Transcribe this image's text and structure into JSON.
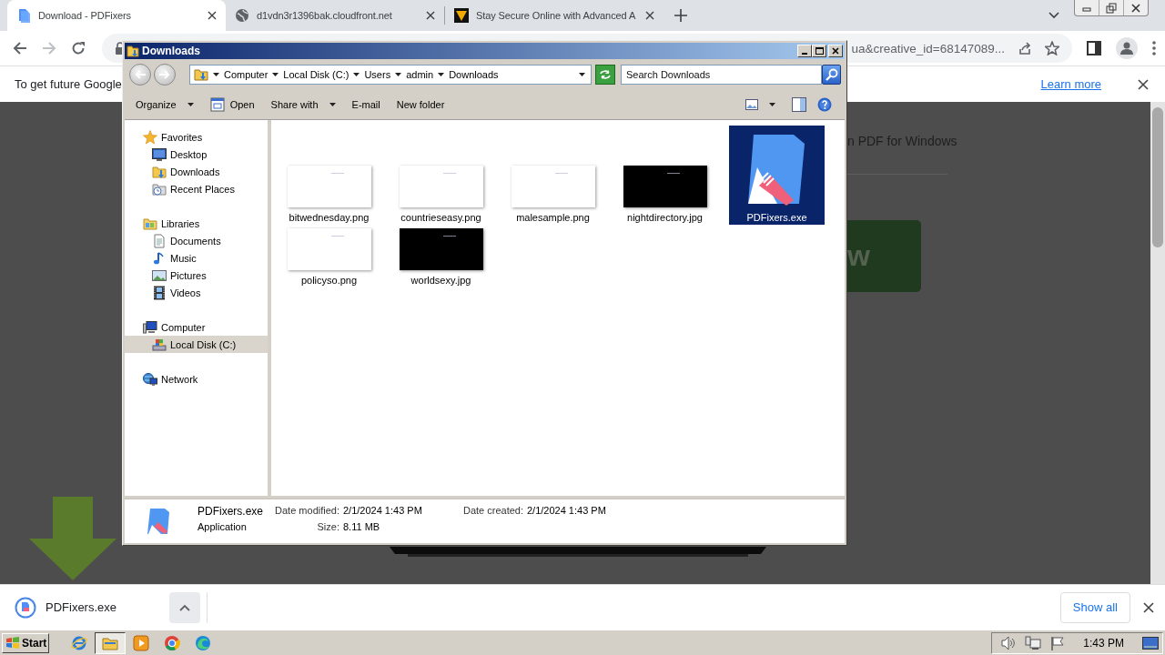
{
  "browser": {
    "tabs": [
      {
        "title": "Download - PDFixers",
        "selected": true
      },
      {
        "title": "d1vdn3r1396bak.cloudfront.net",
        "selected": false
      },
      {
        "title": "Stay Secure Online with Advanced A",
        "selected": false
      }
    ],
    "url": "ua&creative_id=68147089...",
    "infobar": {
      "message": "To get future Google",
      "link": "Learn more"
    },
    "page": {
      "heading": "n PDF for Windows",
      "button": "w"
    },
    "download_shelf": {
      "file": "PDFixers.exe",
      "show_all": "Show all"
    }
  },
  "explorer": {
    "title": "Downloads",
    "breadcrumb": [
      "Computer",
      "Local Disk (C:)",
      "Users",
      "admin",
      "Downloads"
    ],
    "search_placeholder": "Search Downloads",
    "toolbar": [
      {
        "label": "Organize",
        "kind": "menu"
      },
      {
        "label": "Open",
        "kind": "open"
      },
      {
        "label": "Share with",
        "kind": "menu"
      },
      {
        "label": "E-mail",
        "kind": "plain"
      },
      {
        "label": "New folder",
        "kind": "plain"
      }
    ],
    "nav": [
      {
        "label": "Favorites",
        "kind": "star",
        "selected": false,
        "children": [
          {
            "label": "Desktop",
            "kind": "desktop",
            "selected": false
          },
          {
            "label": "Downloads",
            "kind": "downloads",
            "selected": false
          },
          {
            "label": "Recent Places",
            "kind": "recent",
            "selected": false
          }
        ]
      },
      {
        "label": "Libraries",
        "kind": "libraries",
        "selected": false,
        "children": [
          {
            "label": "Documents",
            "kind": "documents",
            "selected": false
          },
          {
            "label": "Music",
            "kind": "music",
            "selected": false
          },
          {
            "label": "Pictures",
            "kind": "pictures",
            "selected": false
          },
          {
            "label": "Videos",
            "kind": "videos",
            "selected": false
          }
        ]
      },
      {
        "label": "Computer",
        "kind": "computer",
        "selected": false,
        "children": [
          {
            "label": "Local Disk (C:)",
            "kind": "disk",
            "selected": true
          }
        ]
      },
      {
        "label": "Network",
        "kind": "network",
        "selected": false
      }
    ],
    "files": [
      {
        "name": "bitwednesday.png",
        "kind": "image",
        "color": "#ffffff",
        "selected": false
      },
      {
        "name": "countrieseasy.png",
        "kind": "image",
        "color": "#ffffff",
        "selected": false
      },
      {
        "name": "malesample.png",
        "kind": "image",
        "color": "#ffffff",
        "selected": false
      },
      {
        "name": "nightdirectory.jpg",
        "kind": "image",
        "color": "#000000",
        "selected": false
      },
      {
        "name": "PDFixers.exe",
        "kind": "application",
        "selected": true
      },
      {
        "name": "policyso.png",
        "kind": "image",
        "color": "#ffffff",
        "selected": false
      },
      {
        "name": "worldsexy.jpg",
        "kind": "image",
        "color": "#000000",
        "selected": false
      }
    ],
    "details": {
      "name": "PDFixers.exe",
      "type": "Application",
      "fields": [
        {
          "label": "Date modified:",
          "value": "2/1/2024 1:43 PM"
        },
        {
          "label": "Date created:",
          "value": "2/1/2024 1:43 PM"
        },
        {
          "label": "Size:",
          "value": "8.11 MB"
        }
      ]
    }
  },
  "taskbar": {
    "start": "Start",
    "clock": "1:43 PM"
  }
}
